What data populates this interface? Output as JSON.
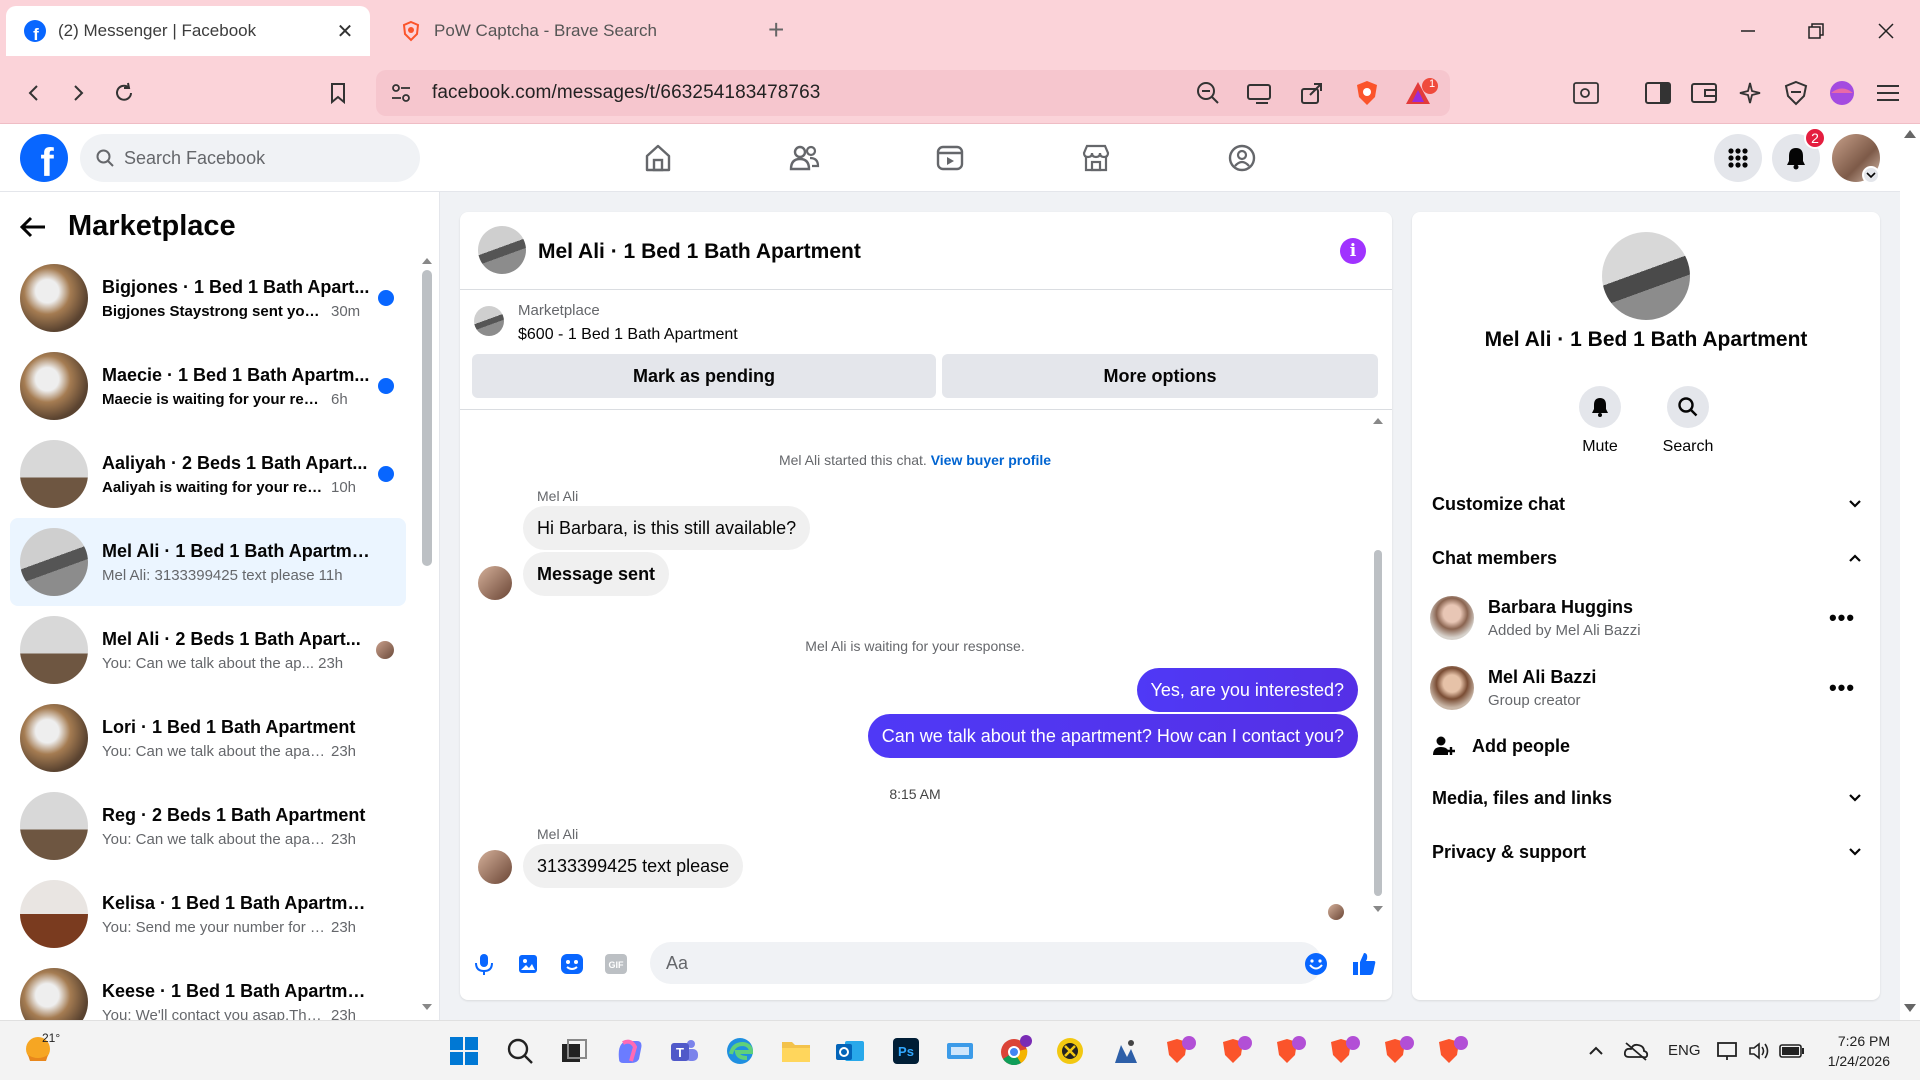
{
  "browser": {
    "tabs": [
      {
        "title": "(2) Messenger | Facebook",
        "active": true
      },
      {
        "title": "PoW Captcha - Brave Search",
        "active": false
      }
    ],
    "url": "facebook.com/messages/t/663254183478763",
    "rewards_badge": "1"
  },
  "fb": {
    "search_placeholder": "Search Facebook",
    "notifications_count": "2",
    "brand_color": "#0866ff"
  },
  "left_panel": {
    "title": "Marketplace",
    "conversations": [
      {
        "title": "Bigjones · 1 Bed 1 Bath Apart...",
        "preview": "Bigjones Staystrong sent you ...",
        "time": "30m",
        "unread": true
      },
      {
        "title": "Maecie · 1 Bed 1 Bath Apartm...",
        "preview": "Maecie is waiting for your resp...",
        "time": "6h",
        "unread": true
      },
      {
        "title": "Aaliyah · 2 Beds 1 Bath Apart...",
        "preview": "Aaliyah is waiting for your res...",
        "time": "10h",
        "unread": true
      },
      {
        "title": "Mel Ali · 1 Bed 1 Bath Apartment",
        "preview": "Mel Ali: 3133399425 text please",
        "time": "11h",
        "unread": false,
        "active": true
      },
      {
        "title": "Mel Ali · 2 Beds 1 Bath Apart...",
        "preview": "You: Can we talk about the ap...",
        "time": "23h",
        "unread": false,
        "seen": true
      },
      {
        "title": "Lori · 1 Bed 1 Bath Apartment",
        "preview": "You: Can we talk about the apart...",
        "time": "23h",
        "unread": false
      },
      {
        "title": "Reg · 2 Beds 1 Bath Apartment",
        "preview": "You: Can we talk about the apart...",
        "time": "23h",
        "unread": false
      },
      {
        "title": "Kelisa · 1 Bed 1 Bath Apartment",
        "preview": "You: Send me your number for fu...",
        "time": "23h",
        "unread": false
      },
      {
        "title": "Keese · 1 Bed 1 Bath Apartment",
        "preview": "You: We'll contact you asap.Than...",
        "time": "23h",
        "unread": false
      }
    ]
  },
  "chat": {
    "title": "Mel Ali · 1 Bed 1 Bath Apartment",
    "marketplace_label": "Marketplace",
    "listing": "$600 - 1 Bed 1 Bath Apartment",
    "btn_pending": "Mark as pending",
    "btn_more": "More options",
    "started_text": "Mel Ali started this chat.",
    "view_profile": "View buyer profile",
    "sender1": "Mel Ali",
    "msg1": "Hi Barbara, is this still available?",
    "msg2": "Message sent",
    "waiting_text": "Mel Ali is waiting for your response.",
    "out1": "Yes, are you interested?",
    "out2": "Can we talk about the apartment? How can I contact you?",
    "timestamp": "8:15 AM",
    "sender2": "Mel Ali",
    "msg3": "3133399425 text please",
    "input_placeholder": "Aa",
    "outgoing_color": "#4f39f6"
  },
  "right_panel": {
    "title": "Mel Ali · 1 Bed 1 Bath Apartment",
    "mute_label": "Mute",
    "search_label": "Search",
    "customize": "Customize chat",
    "chat_members": "Chat members",
    "members": [
      {
        "name": "Barbara Huggins",
        "role": "Added by Mel Ali Bazzi"
      },
      {
        "name": "Mel Ali Bazzi",
        "role": "Group creator"
      }
    ],
    "add_people": "Add people",
    "media": "Media, files and links",
    "privacy": "Privacy & support"
  },
  "taskbar": {
    "temperature": "21°",
    "language": "ENG",
    "time": "7:26 PM",
    "date": "1/24/2026"
  }
}
